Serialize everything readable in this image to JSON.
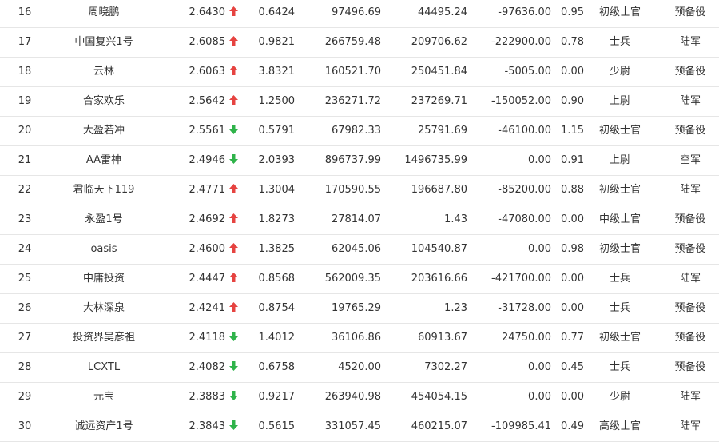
{
  "colors": {
    "up": "#e64340",
    "down": "#2fb34a",
    "text": "#333333"
  },
  "rows": [
    {
      "rank": "16",
      "name": "周晓鹏",
      "value": "2.6430",
      "trend": "up",
      "ratio": "0.6424",
      "m1": "97496.69",
      "m2": "44495.24",
      "m3": "-97636.00",
      "ratio2": "0.95",
      "title": "初级士官",
      "branch": "预备役"
    },
    {
      "rank": "17",
      "name": "中国复兴1号",
      "value": "2.6085",
      "trend": "up",
      "ratio": "0.9821",
      "m1": "266759.48",
      "m2": "209706.62",
      "m3": "-222900.00",
      "ratio2": "0.78",
      "title": "士兵",
      "branch": "陆军"
    },
    {
      "rank": "18",
      "name": "云林",
      "value": "2.6063",
      "trend": "up",
      "ratio": "3.8321",
      "m1": "160521.70",
      "m2": "250451.84",
      "m3": "-5005.00",
      "ratio2": "0.00",
      "title": "少尉",
      "branch": "预备役"
    },
    {
      "rank": "19",
      "name": "合家欢乐",
      "value": "2.5642",
      "trend": "up",
      "ratio": "1.2500",
      "m1": "236271.72",
      "m2": "237269.71",
      "m3": "-150052.00",
      "ratio2": "0.90",
      "title": "上尉",
      "branch": "陆军"
    },
    {
      "rank": "20",
      "name": "大盈若冲",
      "value": "2.5561",
      "trend": "down",
      "ratio": "0.5791",
      "m1": "67982.33",
      "m2": "25791.69",
      "m3": "-46100.00",
      "ratio2": "1.15",
      "title": "初级士官",
      "branch": "预备役"
    },
    {
      "rank": "21",
      "name": "AA雷神",
      "value": "2.4946",
      "trend": "down",
      "ratio": "2.0393",
      "m1": "896737.99",
      "m2": "1496735.99",
      "m3": "0.00",
      "ratio2": "0.91",
      "title": "上尉",
      "branch": "空军"
    },
    {
      "rank": "22",
      "name": "君临天下119",
      "value": "2.4771",
      "trend": "up",
      "ratio": "1.3004",
      "m1": "170590.55",
      "m2": "196687.80",
      "m3": "-85200.00",
      "ratio2": "0.88",
      "title": "初级士官",
      "branch": "陆军"
    },
    {
      "rank": "23",
      "name": "永盈1号",
      "value": "2.4692",
      "trend": "up",
      "ratio": "1.8273",
      "m1": "27814.07",
      "m2": "1.43",
      "m3": "-47080.00",
      "ratio2": "0.00",
      "title": "中级士官",
      "branch": "预备役"
    },
    {
      "rank": "24",
      "name": "oasis",
      "value": "2.4600",
      "trend": "up",
      "ratio": "1.3825",
      "m1": "62045.06",
      "m2": "104540.87",
      "m3": "0.00",
      "ratio2": "0.98",
      "title": "初级士官",
      "branch": "预备役"
    },
    {
      "rank": "25",
      "name": "中庸投资",
      "value": "2.4447",
      "trend": "up",
      "ratio": "0.8568",
      "m1": "562009.35",
      "m2": "203616.66",
      "m3": "-421700.00",
      "ratio2": "0.00",
      "title": "士兵",
      "branch": "陆军"
    },
    {
      "rank": "26",
      "name": "大林深泉",
      "value": "2.4241",
      "trend": "up",
      "ratio": "0.8754",
      "m1": "19765.29",
      "m2": "1.23",
      "m3": "-31728.00",
      "ratio2": "0.00",
      "title": "士兵",
      "branch": "预备役"
    },
    {
      "rank": "27",
      "name": "投资界吴彦祖",
      "value": "2.4118",
      "trend": "down",
      "ratio": "1.4012",
      "m1": "36106.86",
      "m2": "60913.67",
      "m3": "24750.00",
      "ratio2": "0.77",
      "title": "初级士官",
      "branch": "预备役"
    },
    {
      "rank": "28",
      "name": "LCXTL",
      "value": "2.4082",
      "trend": "down",
      "ratio": "0.6758",
      "m1": "4520.00",
      "m2": "7302.27",
      "m3": "0.00",
      "ratio2": "0.45",
      "title": "士兵",
      "branch": "预备役"
    },
    {
      "rank": "29",
      "name": "元宝",
      "value": "2.3883",
      "trend": "down",
      "ratio": "0.9217",
      "m1": "263940.98",
      "m2": "454054.15",
      "m3": "0.00",
      "ratio2": "0.00",
      "title": "少尉",
      "branch": "陆军"
    },
    {
      "rank": "30",
      "name": "诚远资产1号",
      "value": "2.3843",
      "trend": "down",
      "ratio": "0.5615",
      "m1": "331057.45",
      "m2": "460215.07",
      "m3": "-109985.41",
      "ratio2": "0.49",
      "title": "高级士官",
      "branch": "陆军"
    }
  ]
}
